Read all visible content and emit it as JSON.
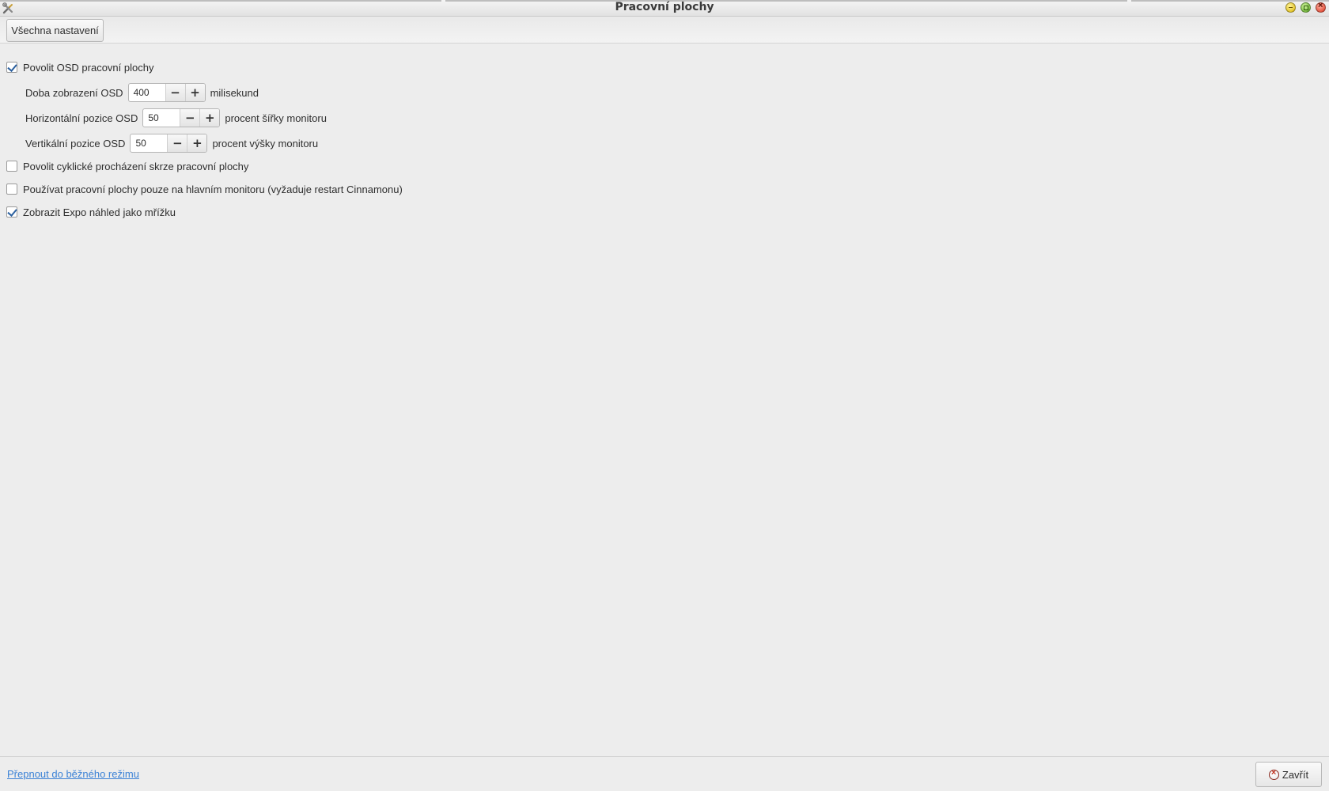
{
  "window": {
    "title": "Pracovní plochy",
    "icon": "tools-icon"
  },
  "toolbar": {
    "all_settings_label": "Všechna nastavení"
  },
  "settings": {
    "osd_enable": {
      "label": "Povolit OSD pracovní plochy",
      "checked": true
    },
    "osd_duration": {
      "label": "Doba zobrazení OSD",
      "value": "400",
      "unit": "milisekund"
    },
    "osd_horizontal": {
      "label": "Horizontální pozice OSD",
      "value": "50",
      "unit": "procent šířky monitoru"
    },
    "osd_vertical": {
      "label": "Vertikální pozice OSD",
      "value": "50",
      "unit": "procent výšky monitoru"
    },
    "cycle_enable": {
      "label": "Povolit cyklické procházení skrze pracovní plochy",
      "checked": false
    },
    "primary_only": {
      "label": "Používat pracovní plochy pouze na hlavním monitoru (vyžaduje restart Cinnamonu)",
      "checked": false
    },
    "expo_grid": {
      "label": "Zobrazit Expo náhled jako mřížku",
      "checked": true
    }
  },
  "spin": {
    "minus": "−",
    "plus": "+"
  },
  "footer": {
    "mode_link": "Přepnout do běžného režimu",
    "close_label": "Zavřít"
  }
}
